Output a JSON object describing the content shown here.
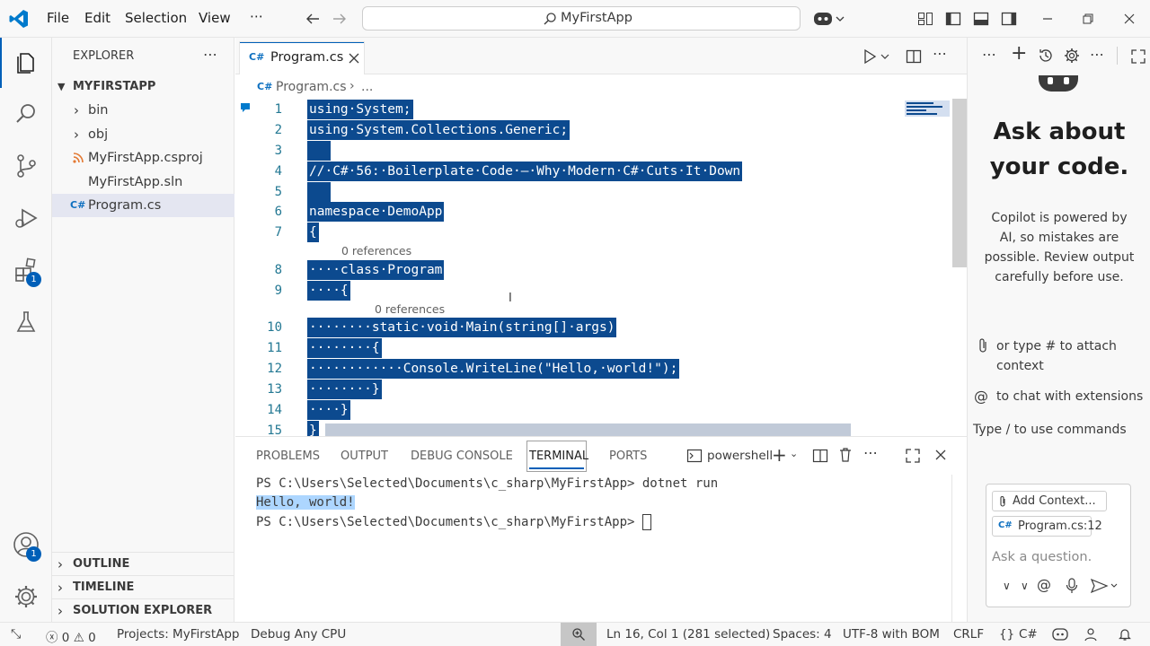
{
  "titlebar": {
    "menu": [
      "File",
      "Edit",
      "Selection",
      "View",
      "⋯"
    ],
    "search": "MyFirstApp"
  },
  "explorer": {
    "title": "EXPLORER",
    "project": "MYFIRSTAPP",
    "items": [
      "bin",
      "obj",
      "MyFirstApp.csproj",
      "MyFirstApp.sln",
      "Program.cs"
    ],
    "sections": [
      "OUTLINE",
      "TIMELINE",
      "SOLUTION EXPLORER"
    ]
  },
  "badges": {
    "extensions": "1",
    "accounts": "1"
  },
  "editor": {
    "tab": "Program.cs",
    "breadcrumb": "Program.cs",
    "breadcrumb_more": "...",
    "lines": [
      {
        "n": "1",
        "text": "using·System;"
      },
      {
        "n": "2",
        "text": "using·System.Collections.Generic;"
      },
      {
        "n": "3",
        "text": ""
      },
      {
        "n": "4",
        "text": "//·C#·56:·Boilerplate·Code·–·Why·Modern·C#·Cuts·It·Down"
      },
      {
        "n": "5",
        "text": ""
      },
      {
        "n": "6",
        "text": "namespace·DemoApp"
      },
      {
        "n": "7",
        "text": "{"
      },
      {
        "n": "8",
        "text": "····class·Program"
      },
      {
        "n": "9",
        "text": "····{"
      },
      {
        "n": "10",
        "text": "········static·void·Main(string[]·args)"
      },
      {
        "n": "11",
        "text": "········{"
      },
      {
        "n": "12",
        "text": "············Console.WriteLine(\"Hello,·world!\");"
      },
      {
        "n": "13",
        "text": "········}"
      },
      {
        "n": "14",
        "text": "····}"
      },
      {
        "n": "15",
        "text": "}"
      }
    ],
    "references": "0 references"
  },
  "panel": {
    "tabs": [
      "PROBLEMS",
      "OUTPUT",
      "DEBUG CONSOLE",
      "TERMINAL",
      "PORTS"
    ],
    "shell": "powershell",
    "terminal": {
      "prompt": "PS C:\\Users\\Selected\\Documents\\c_sharp\\MyFirstApp>",
      "command": "dotnet run",
      "output": "Hello, world!"
    }
  },
  "chat": {
    "heading": "Ask about your code.",
    "disclaimer": "Copilot is powered by AI, so mistakes are possible. Review output carefully before use.",
    "hint_attach": "or type # to attach context",
    "hint_extensions": "to chat with extensions",
    "hint_commands": "Type / to use commands",
    "add_context": "Add Context...",
    "context_file": "Program.cs:12",
    "placeholder": "Ask a question."
  },
  "status": {
    "errors": "0",
    "warnings": "0",
    "project": "Projects: MyFirstApp",
    "config": "Debug Any CPU",
    "position": "Ln 16, Col 1 (281 selected)",
    "spaces": "Spaces: 4",
    "encoding": "UTF-8 with BOM",
    "eol": "CRLF",
    "language": "C#"
  },
  "colors": {
    "accent": "#005fb8",
    "selection": "#0c4a8f",
    "vscode_blue": "#007acc"
  }
}
